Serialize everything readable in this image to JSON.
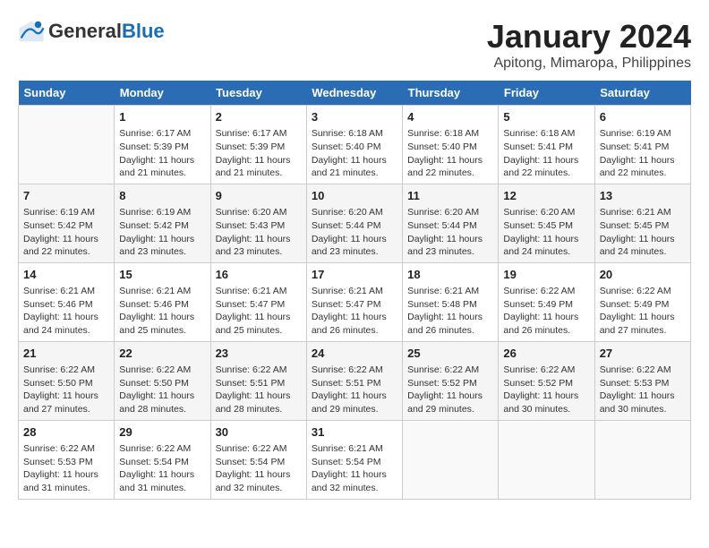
{
  "header": {
    "logo_general": "General",
    "logo_blue": "Blue",
    "month_title": "January 2024",
    "location": "Apitong, Mimaropa, Philippines"
  },
  "days_of_week": [
    "Sunday",
    "Monday",
    "Tuesday",
    "Wednesday",
    "Thursday",
    "Friday",
    "Saturday"
  ],
  "weeks": [
    [
      {
        "day": "",
        "info": ""
      },
      {
        "day": "1",
        "info": "Sunrise: 6:17 AM\nSunset: 5:39 PM\nDaylight: 11 hours and 21 minutes."
      },
      {
        "day": "2",
        "info": "Sunrise: 6:17 AM\nSunset: 5:39 PM\nDaylight: 11 hours and 21 minutes."
      },
      {
        "day": "3",
        "info": "Sunrise: 6:18 AM\nSunset: 5:40 PM\nDaylight: 11 hours and 21 minutes."
      },
      {
        "day": "4",
        "info": "Sunrise: 6:18 AM\nSunset: 5:40 PM\nDaylight: 11 hours and 22 minutes."
      },
      {
        "day": "5",
        "info": "Sunrise: 6:18 AM\nSunset: 5:41 PM\nDaylight: 11 hours and 22 minutes."
      },
      {
        "day": "6",
        "info": "Sunrise: 6:19 AM\nSunset: 5:41 PM\nDaylight: 11 hours and 22 minutes."
      }
    ],
    [
      {
        "day": "7",
        "info": "Sunrise: 6:19 AM\nSunset: 5:42 PM\nDaylight: 11 hours and 22 minutes."
      },
      {
        "day": "8",
        "info": "Sunrise: 6:19 AM\nSunset: 5:42 PM\nDaylight: 11 hours and 23 minutes."
      },
      {
        "day": "9",
        "info": "Sunrise: 6:20 AM\nSunset: 5:43 PM\nDaylight: 11 hours and 23 minutes."
      },
      {
        "day": "10",
        "info": "Sunrise: 6:20 AM\nSunset: 5:44 PM\nDaylight: 11 hours and 23 minutes."
      },
      {
        "day": "11",
        "info": "Sunrise: 6:20 AM\nSunset: 5:44 PM\nDaylight: 11 hours and 23 minutes."
      },
      {
        "day": "12",
        "info": "Sunrise: 6:20 AM\nSunset: 5:45 PM\nDaylight: 11 hours and 24 minutes."
      },
      {
        "day": "13",
        "info": "Sunrise: 6:21 AM\nSunset: 5:45 PM\nDaylight: 11 hours and 24 minutes."
      }
    ],
    [
      {
        "day": "14",
        "info": "Sunrise: 6:21 AM\nSunset: 5:46 PM\nDaylight: 11 hours and 24 minutes."
      },
      {
        "day": "15",
        "info": "Sunrise: 6:21 AM\nSunset: 5:46 PM\nDaylight: 11 hours and 25 minutes."
      },
      {
        "day": "16",
        "info": "Sunrise: 6:21 AM\nSunset: 5:47 PM\nDaylight: 11 hours and 25 minutes."
      },
      {
        "day": "17",
        "info": "Sunrise: 6:21 AM\nSunset: 5:47 PM\nDaylight: 11 hours and 26 minutes."
      },
      {
        "day": "18",
        "info": "Sunrise: 6:21 AM\nSunset: 5:48 PM\nDaylight: 11 hours and 26 minutes."
      },
      {
        "day": "19",
        "info": "Sunrise: 6:22 AM\nSunset: 5:49 PM\nDaylight: 11 hours and 26 minutes."
      },
      {
        "day": "20",
        "info": "Sunrise: 6:22 AM\nSunset: 5:49 PM\nDaylight: 11 hours and 27 minutes."
      }
    ],
    [
      {
        "day": "21",
        "info": "Sunrise: 6:22 AM\nSunset: 5:50 PM\nDaylight: 11 hours and 27 minutes."
      },
      {
        "day": "22",
        "info": "Sunrise: 6:22 AM\nSunset: 5:50 PM\nDaylight: 11 hours and 28 minutes."
      },
      {
        "day": "23",
        "info": "Sunrise: 6:22 AM\nSunset: 5:51 PM\nDaylight: 11 hours and 28 minutes."
      },
      {
        "day": "24",
        "info": "Sunrise: 6:22 AM\nSunset: 5:51 PM\nDaylight: 11 hours and 29 minutes."
      },
      {
        "day": "25",
        "info": "Sunrise: 6:22 AM\nSunset: 5:52 PM\nDaylight: 11 hours and 29 minutes."
      },
      {
        "day": "26",
        "info": "Sunrise: 6:22 AM\nSunset: 5:52 PM\nDaylight: 11 hours and 30 minutes."
      },
      {
        "day": "27",
        "info": "Sunrise: 6:22 AM\nSunset: 5:53 PM\nDaylight: 11 hours and 30 minutes."
      }
    ],
    [
      {
        "day": "28",
        "info": "Sunrise: 6:22 AM\nSunset: 5:53 PM\nDaylight: 11 hours and 31 minutes."
      },
      {
        "day": "29",
        "info": "Sunrise: 6:22 AM\nSunset: 5:54 PM\nDaylight: 11 hours and 31 minutes."
      },
      {
        "day": "30",
        "info": "Sunrise: 6:22 AM\nSunset: 5:54 PM\nDaylight: 11 hours and 32 minutes."
      },
      {
        "day": "31",
        "info": "Sunrise: 6:21 AM\nSunset: 5:54 PM\nDaylight: 11 hours and 32 minutes."
      },
      {
        "day": "",
        "info": ""
      },
      {
        "day": "",
        "info": ""
      },
      {
        "day": "",
        "info": ""
      }
    ]
  ]
}
